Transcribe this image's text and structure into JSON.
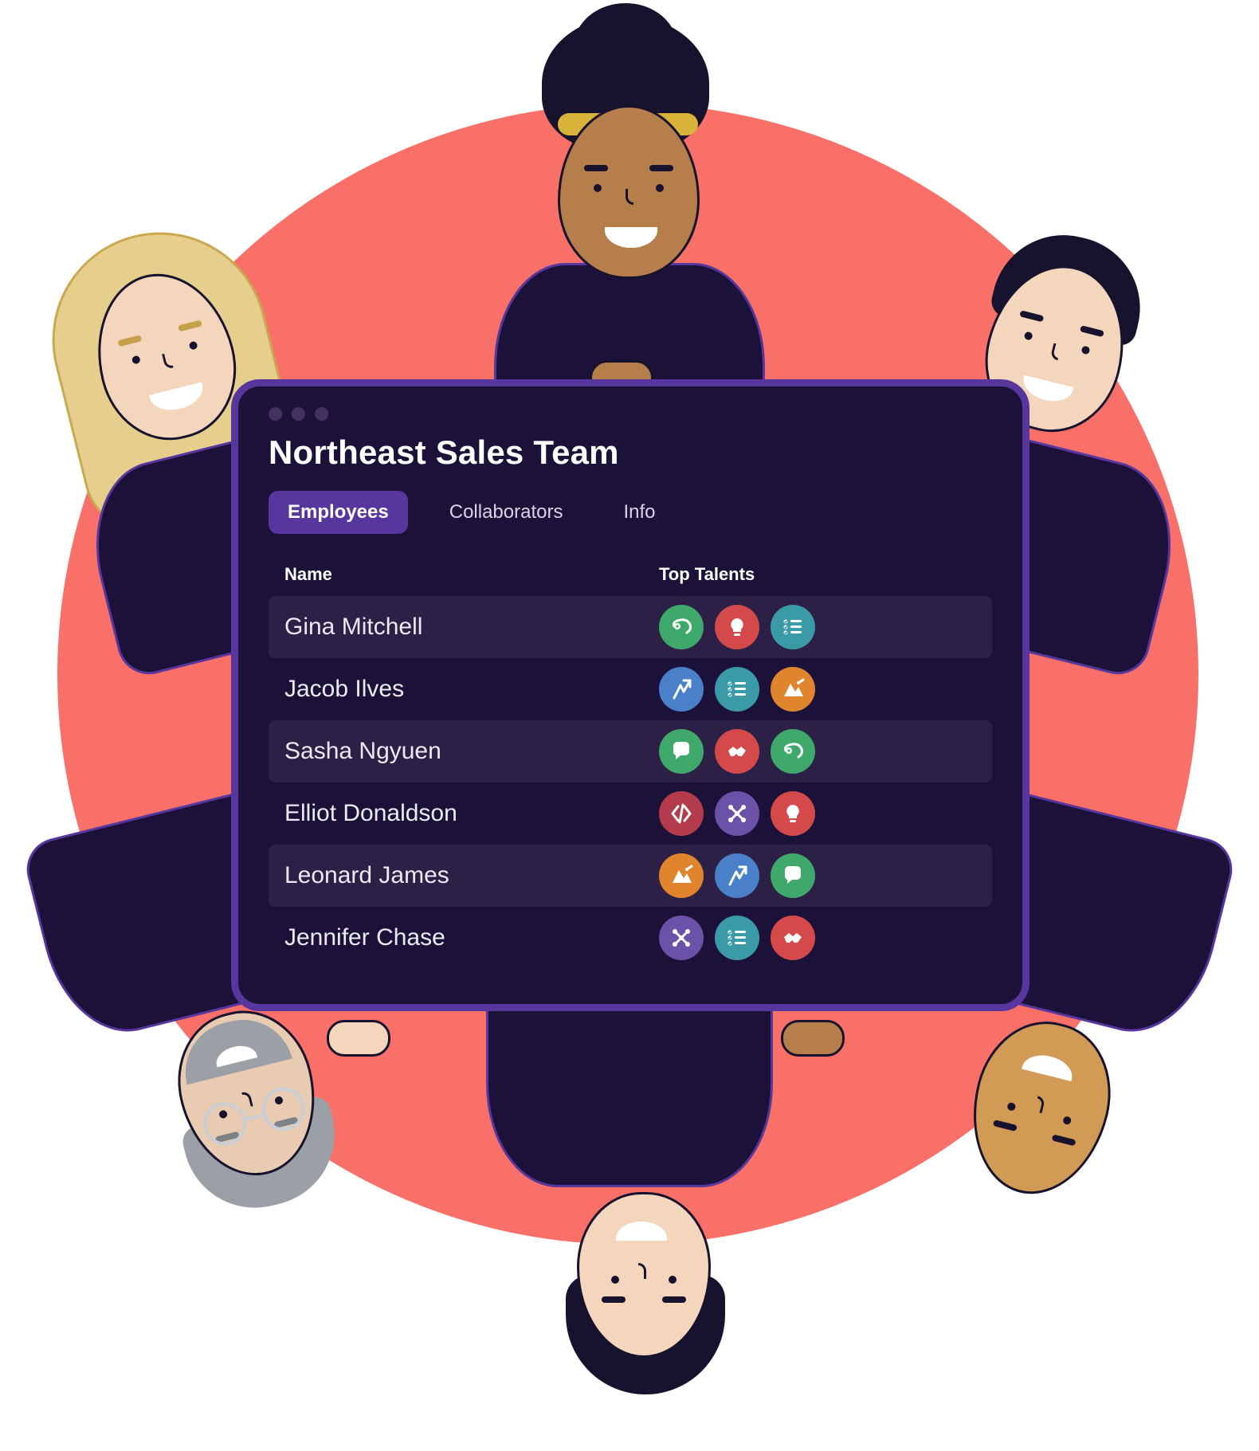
{
  "card": {
    "title": "Northeast Sales Team",
    "tabs": [
      {
        "label": "Employees",
        "active": true
      },
      {
        "label": "Collaborators",
        "active": false
      },
      {
        "label": "Info",
        "active": false
      }
    ],
    "columns": {
      "name": "Name",
      "talents": "Top Talents"
    },
    "rows": [
      {
        "name": "Gina Mitchell",
        "talents": [
          {
            "icon": "chameleon",
            "color": "green"
          },
          {
            "icon": "bulb",
            "color": "red"
          },
          {
            "icon": "checklist",
            "color": "teal"
          }
        ]
      },
      {
        "name": "Jacob Ilves",
        "talents": [
          {
            "icon": "path",
            "color": "blue"
          },
          {
            "icon": "checklist",
            "color": "teal"
          },
          {
            "icon": "mountain",
            "color": "orange"
          }
        ]
      },
      {
        "name": "Sasha Ngyuen",
        "talents": [
          {
            "icon": "chat",
            "color": "green"
          },
          {
            "icon": "handshake",
            "color": "red"
          },
          {
            "icon": "chameleon",
            "color": "green"
          }
        ]
      },
      {
        "name": "Elliot Donaldson",
        "talents": [
          {
            "icon": "code",
            "color": "dkred"
          },
          {
            "icon": "network",
            "color": "purple"
          },
          {
            "icon": "bulb",
            "color": "red"
          }
        ]
      },
      {
        "name": "Leonard James",
        "talents": [
          {
            "icon": "mountain",
            "color": "orange"
          },
          {
            "icon": "path",
            "color": "blue"
          },
          {
            "icon": "chat",
            "color": "green"
          }
        ]
      },
      {
        "name": "Jennifer Chase",
        "talents": [
          {
            "icon": "network",
            "color": "purple"
          },
          {
            "icon": "checklist",
            "color": "teal"
          },
          {
            "icon": "handshake",
            "color": "red"
          }
        ]
      }
    ]
  },
  "people": [
    {
      "position": "top-center",
      "skin": "#b57e4b",
      "hair": "#17122e",
      "hairband": "#d9b23a"
    },
    {
      "position": "top-left",
      "skin": "#f4d6bd",
      "hair": "#e6cf8d"
    },
    {
      "position": "top-right",
      "skin": "#f4d6bd",
      "hair": "#17122e"
    },
    {
      "position": "bottom-center",
      "skin": "#f4d6bd",
      "hair": "#17122e"
    },
    {
      "position": "bottom-left",
      "skin": "#e9cbb2",
      "hair": "#9aa0a6",
      "glasses": true,
      "beard": true
    },
    {
      "position": "bottom-right",
      "skin": "#d19a55",
      "hair": null
    }
  ],
  "colors": {
    "accent": "#57369e",
    "card_bg": "#1c1239",
    "circle": "#f97068",
    "row_stripe": "#2c2047"
  }
}
